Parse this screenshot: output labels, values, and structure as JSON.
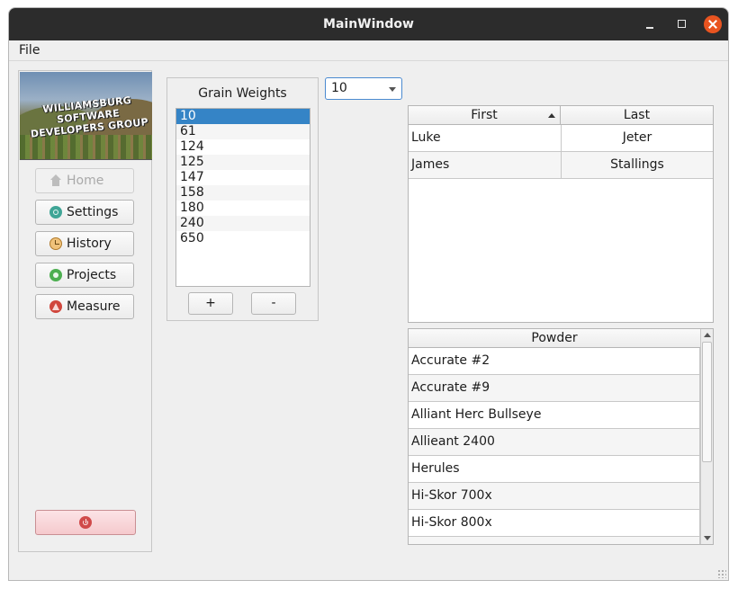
{
  "window": {
    "title": "MainWindow"
  },
  "menu": {
    "file": "File"
  },
  "sidebar": {
    "logo_text": "WILLIAMSBURG SOFTWARE DEVELOPERS GROUP",
    "buttons": [
      {
        "label": "Home",
        "icon": "home-icon",
        "enabled": false
      },
      {
        "label": "Settings",
        "icon": "settings-icon",
        "enabled": true
      },
      {
        "label": "History",
        "icon": "clock-icon",
        "enabled": true
      },
      {
        "label": "Projects",
        "icon": "gear-icon",
        "enabled": true
      },
      {
        "label": "Measure",
        "icon": "compass-icon",
        "enabled": true
      }
    ],
    "power_icon": "power-icon"
  },
  "grain_weights": {
    "title": "Grain Weights",
    "items": [
      "10",
      "61",
      "124",
      "125",
      "147",
      "158",
      "180",
      "240",
      "650"
    ],
    "selected_index": 0,
    "add_label": "+",
    "remove_label": "-"
  },
  "combo": {
    "value": "10"
  },
  "names_table": {
    "headers": [
      "First",
      "Last"
    ],
    "sort_column": "First",
    "rows": [
      {
        "first": "Luke",
        "last": "Jeter"
      },
      {
        "first": "James",
        "last": "Stallings"
      }
    ]
  },
  "powder_table": {
    "header": "Powder",
    "rows": [
      "Accurate #2",
      "Accurate #9",
      "Alliant Herc Bullseye",
      "Allieant 2400",
      "Herules",
      "Hi-Skor 700x",
      "Hi-Skor 800x"
    ]
  },
  "colors": {
    "selection": "#3584c6",
    "close_button": "#e95420",
    "power_button": "#f5c9cd"
  }
}
